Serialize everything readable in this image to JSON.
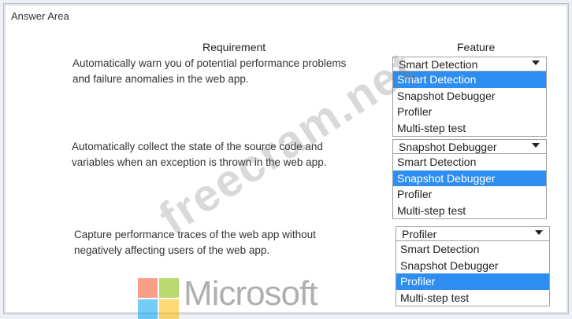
{
  "area_title": "Answer Area",
  "headers": {
    "requirement": "Requirement",
    "feature": "Feature"
  },
  "rows": [
    {
      "requirement": "Automatically warn you of potential performance problems\nand failure anomalies in the web app.",
      "selected": "Smart Detection",
      "options": [
        "Smart Detection",
        "Snapshot Debugger",
        "Profiler",
        "Multi-step test"
      ],
      "highlighted": 0
    },
    {
      "requirement": "Automatically collect the state of the source code and\nvariables when an exception is thrown in the web app.",
      "selected": "Snapshot Debugger",
      "options": [
        "Smart Detection",
        "Snapshot Debugger",
        "Profiler",
        "Multi-step test"
      ],
      "highlighted": 1
    },
    {
      "requirement": "Capture performance traces of the web app without\nnegatively affecting users of the web app.",
      "selected": "Profiler",
      "options": [
        "Smart Detection",
        "Snapshot Debugger",
        "Profiler",
        "Multi-step test"
      ],
      "highlighted": 2
    }
  ],
  "logo_text": "Microsoft",
  "watermark": "freecram.net",
  "colors": {
    "highlight": "#2e8ef0"
  }
}
